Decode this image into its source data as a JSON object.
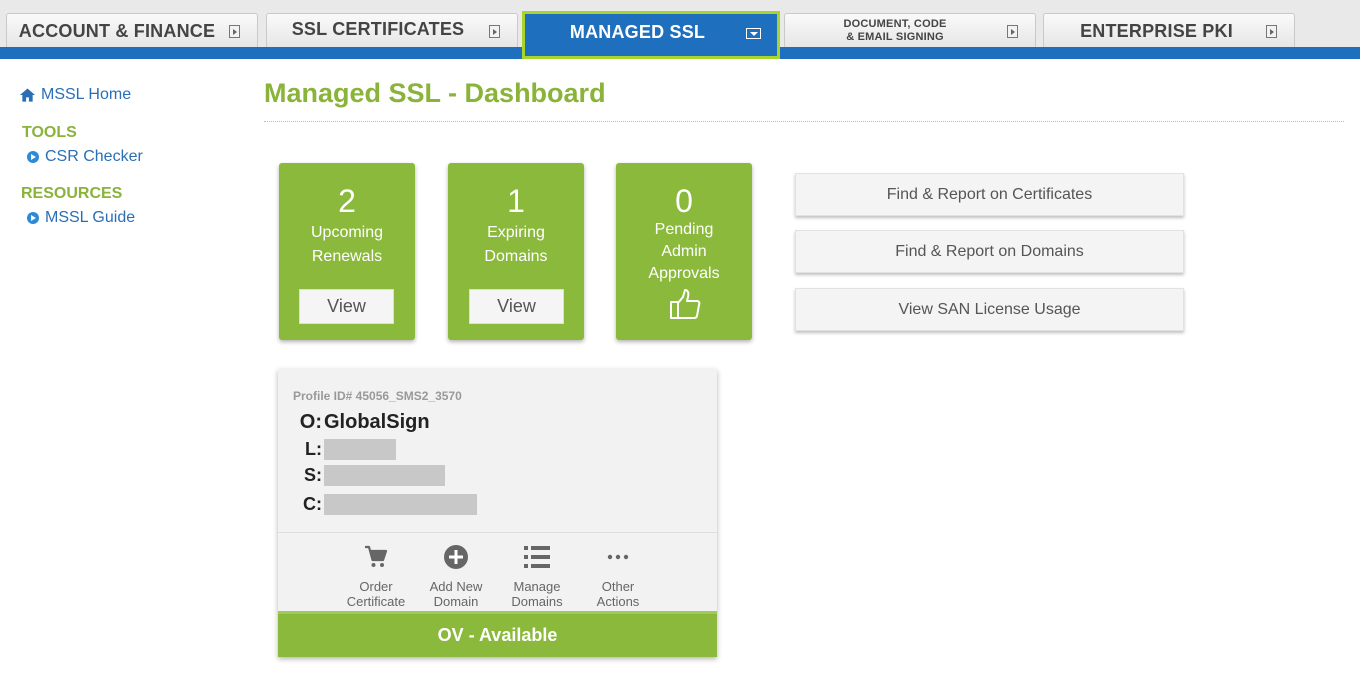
{
  "tabs": [
    {
      "label": "ACCOUNT & FINANCE"
    },
    {
      "label": "SSL CERTIFICATES"
    },
    {
      "label": "MANAGED SSL"
    },
    {
      "label_line1": "DOCUMENT, CODE",
      "label_line2": "& EMAIL SIGNING"
    },
    {
      "label": "ENTERPRISE PKI"
    }
  ],
  "sidebar": {
    "home": "MSSL Home",
    "tools_heading": "TOOLS",
    "csr_checker": "CSR Checker",
    "resources_heading": "RESOURCES",
    "mssl_guide": "MSSL Guide"
  },
  "page_title": "Managed SSL - Dashboard",
  "stats": [
    {
      "value": "2",
      "label_line1": "Upcoming",
      "label_line2": "Renewals",
      "button": "View"
    },
    {
      "value": "1",
      "label_line1": "Expiring",
      "label_line2": "Domains",
      "button": "View"
    },
    {
      "value": "0",
      "label_line1": "Pending",
      "label_line2": "Admin",
      "label_line3": "Approvals"
    }
  ],
  "report_buttons": [
    "Find & Report on Certificates",
    "Find & Report on Domains",
    "View SAN License Usage"
  ],
  "profile": {
    "id": "Profile ID# 45056_SMS2_3570",
    "o_key": "O:",
    "o_value": "GlobalSign",
    "l_key": "L:",
    "s_key": "S:",
    "c_key": "C:",
    "actions": [
      {
        "line1": "Order",
        "line2": "Certificate",
        "icon": "cart-icon"
      },
      {
        "line1": "Add New",
        "line2": "Domain",
        "icon": "plus-circle-icon"
      },
      {
        "line1": "Manage",
        "line2": "Domains",
        "icon": "list-icon"
      },
      {
        "line1": "Other",
        "line2": "Actions",
        "icon": "ellipsis-icon"
      }
    ],
    "status": "OV - Available"
  },
  "colors": {
    "brand_green": "#8ab93c",
    "title_green": "#8ab33a",
    "tab_blue": "#1f6fbf",
    "active_outline": "#a8d42e"
  }
}
